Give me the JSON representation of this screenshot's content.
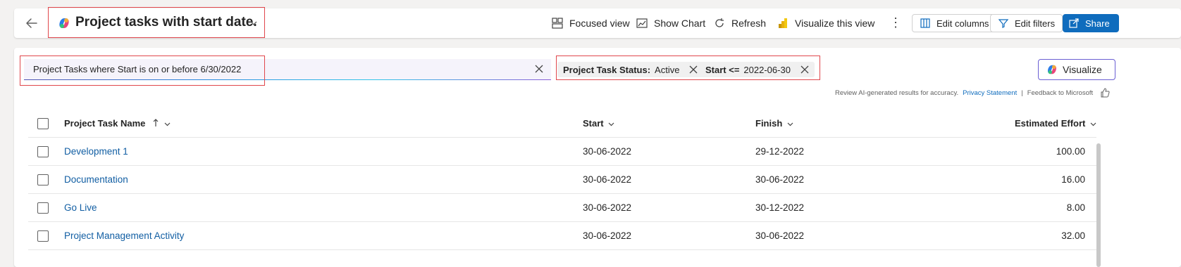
{
  "header": {
    "title": "Project tasks with start date.",
    "commands": {
      "focused_view": "Focused view",
      "show_chart": "Show Chart",
      "refresh": "Refresh",
      "visualize_view": "Visualize this view",
      "edit_columns": "Edit columns",
      "edit_filters": "Edit filters",
      "share": "Share"
    }
  },
  "search": {
    "value": "Project Tasks where Start is on or before 6/30/2022"
  },
  "filters": [
    {
      "label": "Project Task Status:",
      "value": "Active"
    },
    {
      "label": "Start <=",
      "value": "2022-06-30"
    }
  ],
  "visualize_label": "Visualize",
  "ai_note": {
    "text": "Review AI-generated results for accuracy.",
    "privacy": "Privacy Statement",
    "separator": "|",
    "feedback": "Feedback to Microsoft"
  },
  "table": {
    "columns": [
      "Project Task Name",
      "Start",
      "Finish",
      "Estimated Effort"
    ],
    "rows": [
      {
        "name": "Development 1",
        "start": "30-06-2022",
        "finish": "29-12-2022",
        "effort": "100.00"
      },
      {
        "name": "Documentation",
        "start": "30-06-2022",
        "finish": "30-06-2022",
        "effort": "16.00"
      },
      {
        "name": "Go Live",
        "start": "30-06-2022",
        "finish": "30-12-2022",
        "effort": "8.00"
      },
      {
        "name": "Project Management Activity",
        "start": "30-06-2022",
        "finish": "30-06-2022",
        "effort": "32.00"
      }
    ]
  }
}
